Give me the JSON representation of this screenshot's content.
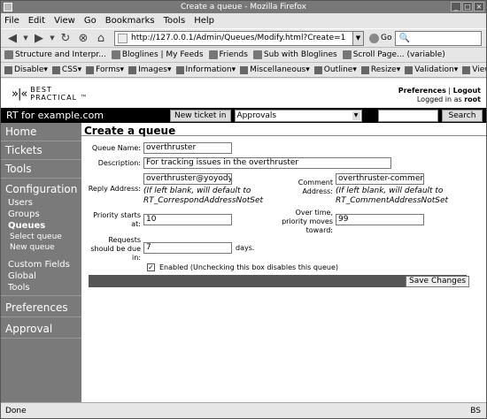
{
  "window": {
    "title": "Create a queue - Mozilla Firefox"
  },
  "menu": [
    "File",
    "Edit",
    "View",
    "Go",
    "Bookmarks",
    "Tools",
    "Help"
  ],
  "nav": {
    "url": "http://127.0.0.1/Admin/Queues/Modify.html?Create=1",
    "go": "Go",
    "search_placeholder": "",
    "search_icon_glyph": "🔍"
  },
  "bookmarks": [
    "Structure and Interpr...",
    "Bloglines | My Feeds",
    "Friends",
    "Sub with Bloglines",
    "Scroll Page... (variable)"
  ],
  "devtoolbar": [
    "Disable",
    "CSS",
    "Forms",
    "Images",
    "Information",
    "Miscellaneous",
    "Outline",
    "Resize",
    "Validation",
    "View Source"
  ],
  "header": {
    "logo_mark": "»|«",
    "logo_line1": "BEST",
    "logo_line2": "PRACTICAL ™",
    "preferences": "Preferences",
    "separator": "|",
    "logout": "Logout",
    "logged_in_prefix": "Logged in as",
    "username": "root"
  },
  "rtbar": {
    "title": "RT for example.com",
    "new_ticket": "New ticket in",
    "queue_selected": "Approvals",
    "search_button": "Search"
  },
  "sidebar": {
    "home": "Home",
    "tickets": "Tickets",
    "tools": "Tools",
    "configuration": "Configuration",
    "users": "Users",
    "groups": "Groups",
    "queues": "Queues",
    "select_queue": "Select queue",
    "new_queue": "New queue",
    "custom_fields": "Custom Fields",
    "global": "Global",
    "tools_sub": "Tools",
    "preferences": "Preferences",
    "approval": "Approval"
  },
  "form": {
    "page_title": "Create a queue",
    "queue_name_label": "Queue Name:",
    "queue_name_value": "overthruster",
    "description_label": "Description:",
    "description_value": "For tracking issues in the overthruster",
    "reply_label": "Reply Address:",
    "reply_value": "overthruster@yoyodyne",
    "reply_hint_1": "(If left blank, will default to",
    "reply_hint_2": "RT_CorrespondAddressNotSet",
    "comment_label_1": "Comment",
    "comment_label_2": "Address:",
    "comment_value": "overthruster-comment@",
    "comment_hint_1": "(If left blank, will default to",
    "comment_hint_2": "RT_CommentAddressNotSet",
    "priority_starts_label_1": "Priority starts",
    "priority_starts_label_2": "at:",
    "priority_starts_value": "10",
    "overtime_label_1": "Over time,",
    "overtime_label_2": "priority moves",
    "overtime_label_3": "toward:",
    "overtime_value": "99",
    "due_label_1": "Requests",
    "due_label_2": "should be due",
    "due_label_3": "in:",
    "due_value": "7",
    "due_unit": "days.",
    "enabled_label": "Enabled (Unchecking this box disables this queue)",
    "enabled_checked": true,
    "save_button": "Save Changes"
  },
  "status": {
    "left": "Done",
    "right": "BS"
  }
}
